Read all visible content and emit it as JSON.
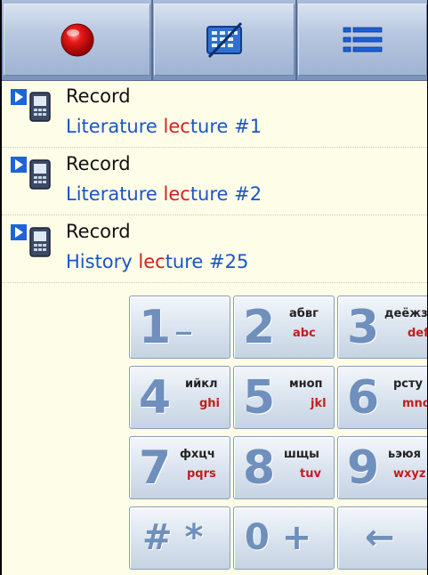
{
  "toolbar": {
    "buttons": [
      {
        "name": "record",
        "icon": "record-icon"
      },
      {
        "name": "keypad-toggle",
        "icon": "keypad-off-icon"
      },
      {
        "name": "list",
        "icon": "list-icon"
      }
    ]
  },
  "recordings": [
    {
      "title": "Record",
      "desc_before": "Literature ",
      "desc_highlight": "lec",
      "desc_after": "ture #1",
      "icon": "play-phone-icon"
    },
    {
      "title": "Record",
      "desc_before": "Literature ",
      "desc_highlight": "lec",
      "desc_after": "ture #2",
      "icon": "play-phone-icon"
    },
    {
      "title": "Record",
      "desc_before": "History ",
      "desc_highlight": "lec",
      "desc_after": "ture #25",
      "icon": "play-phone-icon"
    }
  ],
  "keypad": {
    "keys": [
      {
        "num": "1",
        "cyr": "",
        "lat": "",
        "extra": "_"
      },
      {
        "num": "2",
        "cyr": "абвг",
        "lat": "abc"
      },
      {
        "num": "3",
        "cyr": "деёжз",
        "lat": "def"
      },
      {
        "num": "4",
        "cyr": "ийкл",
        "lat": "ghi"
      },
      {
        "num": "5",
        "cyr": "мноп",
        "lat": "jkl"
      },
      {
        "num": "6",
        "cyr": "рсту",
        "lat": "mno"
      },
      {
        "num": "7",
        "cyr": "фхцч",
        "lat": "pqrs"
      },
      {
        "num": "8",
        "cyr": "шщы",
        "lat": "tuv"
      },
      {
        "num": "9",
        "cyr": "ьэюя",
        "lat": "wxyz"
      },
      {
        "sym": "# *"
      },
      {
        "sym": "0 +"
      },
      {
        "sym": "←"
      }
    ]
  },
  "colors": {
    "background": "#fefde8",
    "title": "#111111",
    "desc": "#1a55c8",
    "highlight": "#d42020",
    "keypad_digit": "#6f8fbd",
    "keypad_latin": "#c21e1e"
  }
}
